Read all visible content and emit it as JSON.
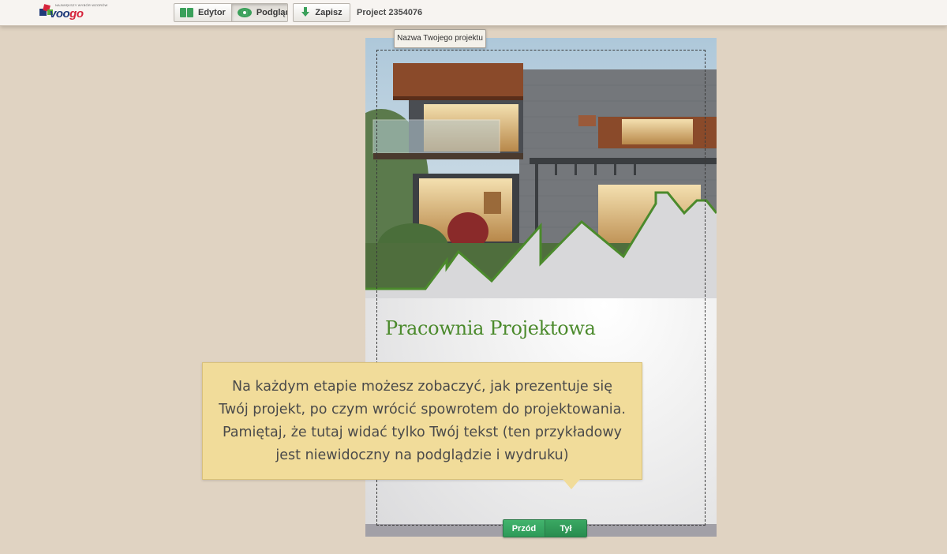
{
  "app": {
    "logo_word_a": "voo",
    "logo_word_b": "go",
    "logo_tagline": "NAJWIĘKSZY WYBÓR WZORÓW"
  },
  "toolbar": {
    "editor_label": "Edytor",
    "preview_label": "Podgląd",
    "save_label": "Zapisz",
    "project_label": "Project 2354076",
    "active_mode": "Podgląd"
  },
  "card": {
    "name_tooltip": "Nazwa Twojego projektu",
    "title": "Pracownia Projektowa",
    "title_color": "#4b8a2c",
    "photo_subject": "modern house exterior",
    "sides": {
      "front_label": "Przód",
      "back_label": "Tył"
    }
  },
  "info_tooltip": {
    "text": "Na każdym etapie możesz zobaczyć, jak prezentuje się Twój projekt, po czym wrócić spowrotem do projektowania. Pamiętaj, że tutaj widać tylko Twój tekst (ten przykładowy jest niewidoczny na podglądzie i wydruku)"
  },
  "colors": {
    "background": "#e0d3c2",
    "accent_green": "#3aa05a",
    "tooltip_yellow": "#f1dc9a"
  }
}
